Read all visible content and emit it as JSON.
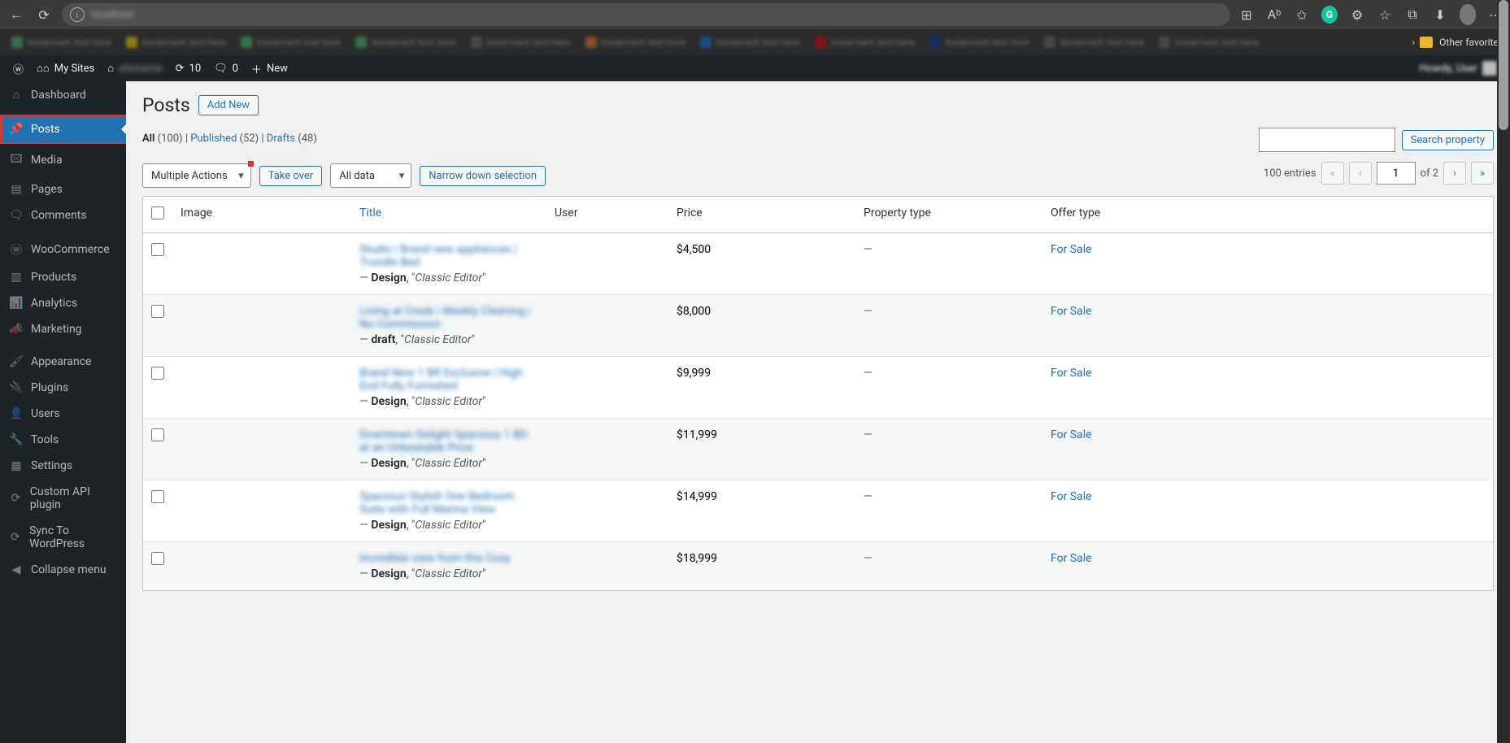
{
  "browser": {
    "addr_blur": "localhost",
    "other_favorites": "Other favorites"
  },
  "bookmarksBlur": [
    {
      "color": "#3aa757"
    },
    {
      "color": "#d4b106"
    },
    {
      "color": "#3aa757"
    },
    {
      "color": "#3aa757"
    },
    {
      "color": "#5c5c5c"
    },
    {
      "color": "#d4621c"
    },
    {
      "color": "#0a66c2"
    },
    {
      "color": "#cc0000"
    },
    {
      "color": "#003580"
    },
    {
      "color": "#5c5c5c"
    },
    {
      "color": "#5c5c5c"
    }
  ],
  "wpbar": {
    "mysites": "My Sites",
    "updates": "10",
    "comments": "0",
    "new": "New"
  },
  "sidebar": [
    {
      "id": "dashboard",
      "label": "Dashboard",
      "icon": "⌂"
    },
    {
      "id": "posts",
      "label": "Posts",
      "icon": "📌",
      "active": true,
      "sep": true
    },
    {
      "id": "media",
      "label": "Media",
      "icon": "🖾"
    },
    {
      "id": "pages",
      "label": "Pages",
      "icon": "▤"
    },
    {
      "id": "comments",
      "label": "Comments",
      "icon": "🗨"
    },
    {
      "id": "woocommerce",
      "label": "WooCommerce",
      "icon": "ⓦ",
      "sep": true
    },
    {
      "id": "products",
      "label": "Products",
      "icon": "▥"
    },
    {
      "id": "analytics",
      "label": "Analytics",
      "icon": "📊"
    },
    {
      "id": "marketing",
      "label": "Marketing",
      "icon": "📣"
    },
    {
      "id": "appearance",
      "label": "Appearance",
      "icon": "🖌",
      "sep": true
    },
    {
      "id": "plugins",
      "label": "Plugins",
      "icon": "🔌"
    },
    {
      "id": "users",
      "label": "Users",
      "icon": "👤"
    },
    {
      "id": "tools",
      "label": "Tools",
      "icon": "🔧"
    },
    {
      "id": "settings",
      "label": "Settings",
      "icon": "▦"
    },
    {
      "id": "customapi",
      "label": "Custom API plugin",
      "icon": "⟳"
    },
    {
      "id": "sync",
      "label": "Sync To WordPress",
      "icon": "⟳"
    },
    {
      "id": "collapse",
      "label": "Collapse menu",
      "icon": "◀"
    }
  ],
  "page": {
    "title": "Posts",
    "add_new": "Add New"
  },
  "filters": {
    "all_label": "All",
    "all_count": "(100)",
    "pub_label": "Published",
    "pub_count": "(52)",
    "drafts_label": "Drafts",
    "drafts_count": "(48)",
    "sep": " | "
  },
  "search": {
    "button": "Search property"
  },
  "actions": {
    "multiple": "Multiple Actions",
    "takeover": "Take over",
    "alldata": "All data",
    "narrow": "Narrow down selection"
  },
  "pager": {
    "entries": "100 entries",
    "page": "1",
    "of": "of 2"
  },
  "columns": {
    "image": "Image",
    "title": "Title",
    "user": "User",
    "price": "Price",
    "ptype": "Property type",
    "otype": "Offer type"
  },
  "design_word": "Design",
  "draft_word": "draft",
  "classic": "Classic Editor",
  "rows": [
    {
      "blur": "Studio | Brand new appliances | Trundle Bed",
      "status": "Design",
      "price": "$4,500",
      "ptype": "—",
      "otype": "For Sale"
    },
    {
      "blur": "Living at Creek | Weekly Cleaning | No Commission",
      "status": "draft",
      "price": "$8,000",
      "ptype": "—",
      "otype": "For Sale"
    },
    {
      "blur": "Brand New 1 BR  Exclusive | High End Fully Furnished",
      "status": "Design",
      "price": "$9,999",
      "ptype": "—",
      "otype": "For Sale"
    },
    {
      "blur": "Downtown Delight Spacious 1 BD at an Unbeatable Price",
      "status": "Design",
      "price": "$11,999",
      "ptype": "—",
      "otype": "For Sale"
    },
    {
      "blur": "Spacious Stylish One Bedroom Suite with Full Marina View",
      "status": "Design",
      "price": "$14,999",
      "ptype": "—",
      "otype": "For Sale"
    },
    {
      "blur": "Incredible view from this Cozy",
      "status": "Design",
      "price": "$18,999",
      "ptype": "—",
      "otype": "For Sale"
    }
  ]
}
